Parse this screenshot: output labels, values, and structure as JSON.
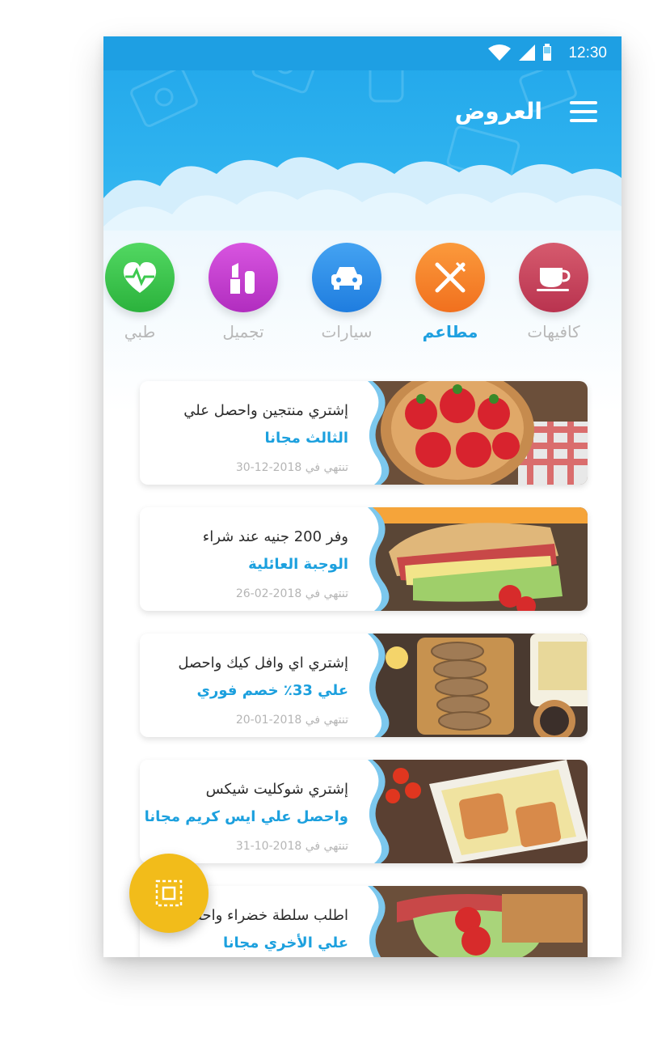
{
  "status_bar": {
    "time": "12:30"
  },
  "header": {
    "title": "العروض"
  },
  "categories": [
    {
      "label": "كافيهات",
      "icon": "coffee-cup-icon",
      "color": "#c8455e",
      "active": false
    },
    {
      "label": "مطاعم",
      "icon": "fork-knife-icon",
      "color": "#f7812a",
      "active": true
    },
    {
      "label": "سيارات",
      "icon": "car-icon",
      "color": "#2f8ee8",
      "active": false
    },
    {
      "label": "تجميل",
      "icon": "lipstick-icon",
      "color": "#c33ccf",
      "active": false
    },
    {
      "label": "طبي",
      "icon": "heart-pulse-icon",
      "color": "#3cc94e",
      "active": false
    }
  ],
  "offers": [
    {
      "line1": "إشتري منتجين واحصل علي",
      "line2": "الثالث مجانا",
      "date": "تنتهي في 2018-12-30",
      "image": "strawberries"
    },
    {
      "line1": "وفر 200 جنيه عند شراء",
      "line2": "الوجبة العائلية",
      "date": "تنتهي في 2018-02-26",
      "image": "sandwich"
    },
    {
      "line1": "إشتري اي وافل كيك واحصل",
      "line2": "علي 33٪ خصم فوري",
      "date": "تنتهي في 2018-01-20",
      "image": "bread"
    },
    {
      "line1": "إشتري شوكليت شيكس",
      "line2": "واحصل علي ايس كريم مجانا",
      "date": "تنتهي في 2018-10-31",
      "image": "salmon"
    },
    {
      "line1": "اطلب سلطة خضراء واحصل",
      "line2": "علي الأخري مجانا",
      "date": "",
      "image": "salad"
    }
  ],
  "colors": {
    "accent": "#1ca0de",
    "fab": "#f2bc1a",
    "header": "#21a6ea"
  },
  "fab": {
    "icon": "scan-icon"
  }
}
